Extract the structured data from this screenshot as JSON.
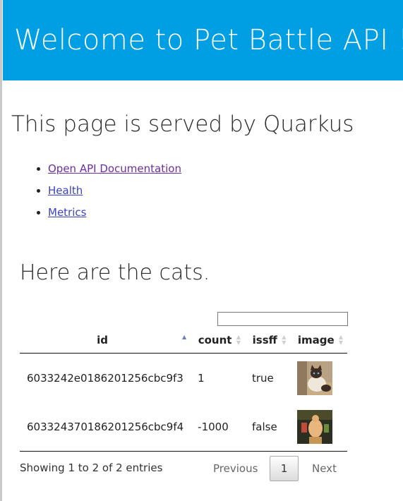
{
  "header": {
    "title": "Welcome to Pet Battle API !"
  },
  "subtitle": "This page is served by Quarkus",
  "links": [
    {
      "label": "Open API Documentation"
    },
    {
      "label": "Health"
    },
    {
      "label": "Metrics"
    }
  ],
  "cats_section": {
    "heading": "Here are the cats.",
    "search": {
      "value": "",
      "placeholder": ""
    },
    "table": {
      "columns": [
        "id",
        "count",
        "issff",
        "image"
      ],
      "sorted_column": "id",
      "sort_direction": "ascending",
      "rows": [
        {
          "id": "6033242e0186201256cbc9f3",
          "count": "1",
          "issff": "true",
          "image_icon": "cat-photo-thumbnail"
        },
        {
          "id": "603324370186201256cbc9f4",
          "count": "-1000",
          "issff": "false",
          "image_icon": "cat-photo-thumbnail"
        }
      ]
    },
    "info": "Showing 1 to 2 of 2 entries",
    "pagination": {
      "previous": "Previous",
      "current_page": "1",
      "next": "Next"
    }
  },
  "colors": {
    "banner": "#009fe3",
    "link": "#3b44c7",
    "visited_link": "#6b2fa3"
  }
}
